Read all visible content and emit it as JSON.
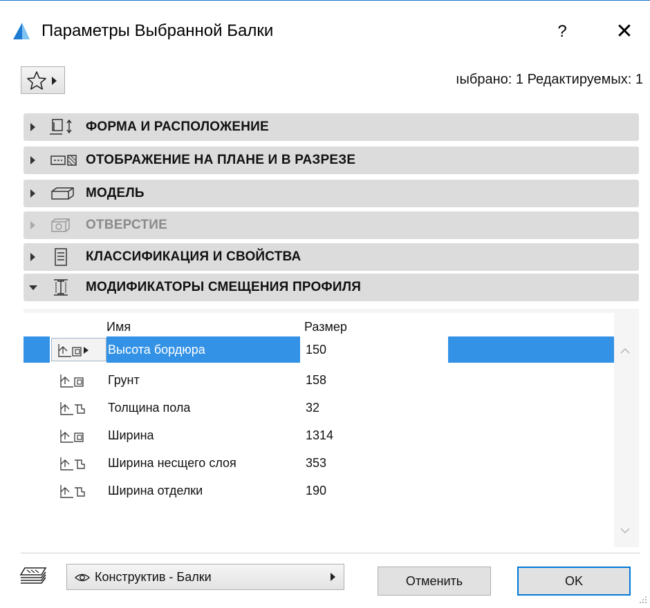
{
  "window": {
    "title": "Параметры Выбранной Балки",
    "help_label": "?",
    "close_label": "✕"
  },
  "toolbar": {
    "selected_info": "ıыбрано: 1 Редактируемых: 1"
  },
  "sections": [
    {
      "label": "ФОРМА И РАСПОЛОЖЕНИЕ",
      "expanded": false,
      "enabled": true,
      "icon": "shape-placement-icon"
    },
    {
      "label": "ОТОБРАЖЕНИЕ НА ПЛАНЕ И В РАЗРЕЗЕ",
      "expanded": false,
      "enabled": true,
      "icon": "plan-section-icon"
    },
    {
      "label": "МОДЕЛЬ",
      "expanded": false,
      "enabled": true,
      "icon": "model-icon"
    },
    {
      "label": "ОТВЕРСТИЕ",
      "expanded": false,
      "enabled": false,
      "icon": "opening-icon"
    },
    {
      "label": "КЛАССИФИКАЦИЯ И СВОЙСТВА",
      "expanded": false,
      "enabled": true,
      "icon": "classification-icon"
    },
    {
      "label": "МОДИФИКАТОРЫ СМЕЩЕНИЯ ПРОФИЛЯ",
      "expanded": true,
      "enabled": true,
      "icon": "profile-beam-icon"
    }
  ],
  "table": {
    "columns": [
      "Имя",
      "Размер"
    ],
    "rows": [
      {
        "name": "Высота бордюра",
        "size": "150",
        "selected": true
      },
      {
        "name": "Грунт",
        "size": "158",
        "selected": false
      },
      {
        "name": "Толщина пола",
        "size": "32",
        "selected": false
      },
      {
        "name": "Ширина",
        "size": "1314",
        "selected": false
      },
      {
        "name": "Ширина несщего слоя",
        "size": "353",
        "selected": false
      },
      {
        "name": "Ширина отделки",
        "size": "190",
        "selected": false
      }
    ]
  },
  "footer": {
    "layer_value": "Конструктив - Балки",
    "cancel_label": "Отменить",
    "ok_label": "OK"
  },
  "colors": {
    "selection": "#3392e6",
    "section_bg": "#dcdcdc",
    "ok_border": "#0078d7"
  }
}
